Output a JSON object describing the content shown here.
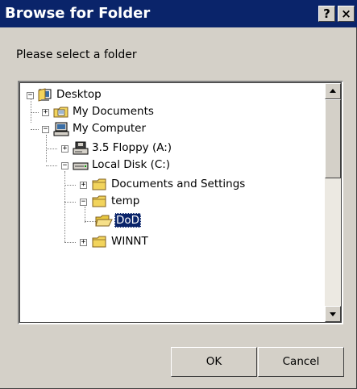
{
  "window": {
    "title": "Browse for Folder",
    "help_label": "?",
    "close_label": "×"
  },
  "prompt": "Please select a folder",
  "tree": {
    "items": [
      {
        "label": "Desktop",
        "expander": "−",
        "icon": "desktop-icon"
      },
      {
        "label": "My Documents",
        "expander": "+",
        "icon": "my-documents-folder-icon"
      },
      {
        "label": "My Computer",
        "expander": "−",
        "icon": "my-computer-icon"
      },
      {
        "label": "3.5 Floppy (A:)",
        "expander": "+",
        "icon": "floppy-drive-icon"
      },
      {
        "label": "Local Disk (C:)",
        "expander": "−",
        "icon": "hard-drive-icon"
      },
      {
        "label": "Documents and Settings",
        "expander": "+",
        "icon": "folder-icon"
      },
      {
        "label": "temp",
        "expander": "−",
        "icon": "folder-open-icon"
      },
      {
        "label": "DoD",
        "expander": "",
        "icon": "folder-open-icon",
        "selected": true
      },
      {
        "label": "WINNT",
        "expander": "+",
        "icon": "folder-icon"
      }
    ]
  },
  "buttons": {
    "ok": "OK",
    "cancel": "Cancel"
  },
  "colors": {
    "title_bar": "#0a246a",
    "dialog_face": "#d4d0c8",
    "selection": "#0a246a",
    "folder": "#f2d45c"
  }
}
